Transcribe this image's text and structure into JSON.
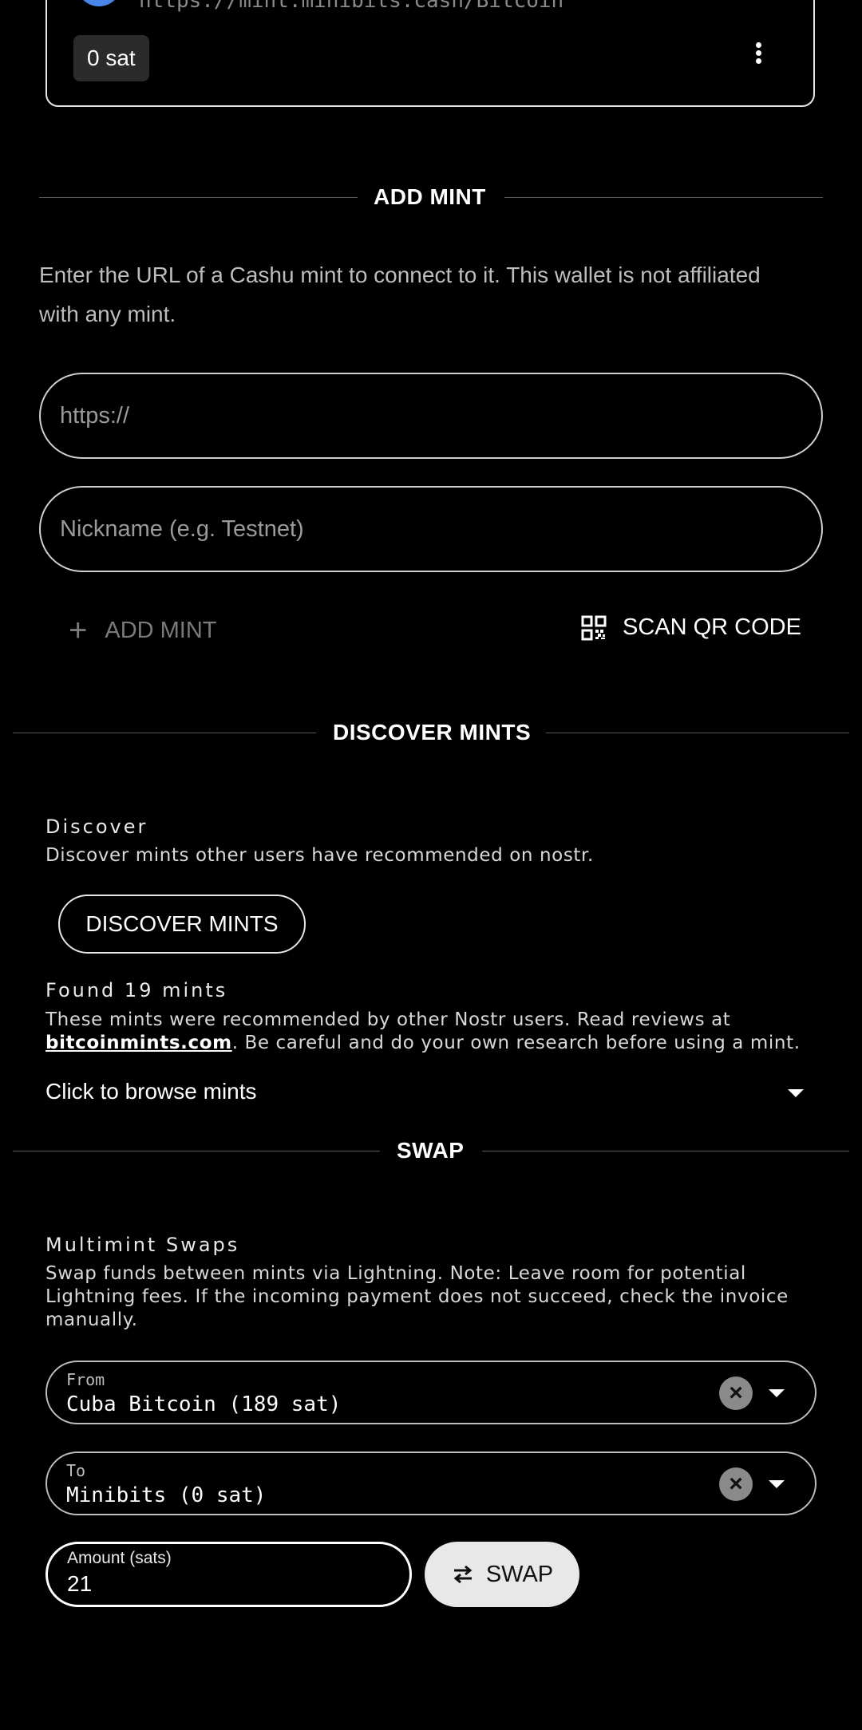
{
  "mint_card": {
    "url": "https://mint.minibits.cash/Bitcoin",
    "balance": "0 sat"
  },
  "add_mint": {
    "section_title": "ADD MINT",
    "description": "Enter the URL of a Cashu mint to connect to it. This wallet is not affiliated with any mint.",
    "url_placeholder": "https://",
    "nickname_placeholder": "Nickname (e.g. Testnet)",
    "add_button": "ADD MINT",
    "scan_button": "SCAN QR CODE"
  },
  "discover": {
    "section_title": "DISCOVER MINTS",
    "heading": "Discover",
    "subtitle": "Discover mints other users have recommended on nostr.",
    "button": "DISCOVER MINTS",
    "found": "Found 19 mints",
    "found_text_before": "These mints were recommended by other Nostr users. Read reviews at",
    "found_link": "bitcoinmints.com",
    "found_text_after": ". Be careful and do your own research before using a mint.",
    "browse": "Click to browse mints"
  },
  "swap": {
    "section_title": "SWAP",
    "heading": "Multimint Swaps",
    "description": "Swap funds between mints via Lightning. Note: Leave room for potential Lightning fees. If the incoming payment does not succeed, check the invoice manually.",
    "from_label": "From",
    "from_value": "Cuba Bitcoin (189 sat)",
    "to_label": "To",
    "to_value": "Minibits (0 sat)",
    "amount_label": "Amount (sats)",
    "amount_value": "21",
    "swap_button": "SWAP"
  }
}
